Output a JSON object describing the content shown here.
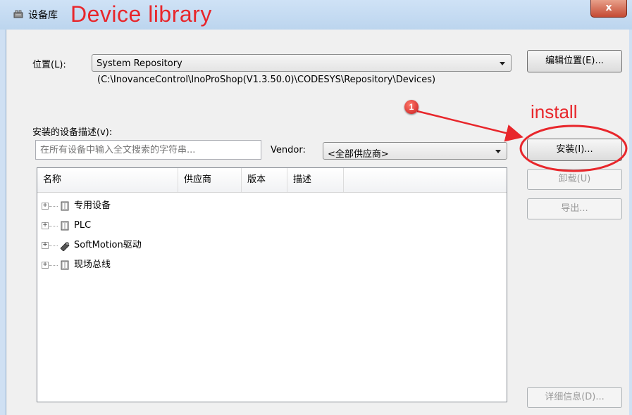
{
  "window": {
    "title": "设备库",
    "title_annotation": "Device library",
    "close_glyph": "x"
  },
  "location": {
    "label": "位置(L):",
    "value": "System Repository",
    "path": "(C:\\InovanceControl\\InoProShop(V1.3.50.0)\\CODESYS\\Repository\\Devices)",
    "edit_button": "编辑位置(E)..."
  },
  "installed": {
    "label": "安装的设备描述(v):",
    "search_placeholder": "在所有设备中输入全文搜索的字符串...",
    "vendor_label": "Vendor:",
    "vendor_value": "<全部供应商>"
  },
  "table": {
    "columns": [
      "名称",
      "供应商",
      "版本",
      "描述"
    ],
    "rows": [
      {
        "label": "专用设备",
        "icon": "device-folder-icon"
      },
      {
        "label": "PLC",
        "icon": "device-folder-icon"
      },
      {
        "label": "SoftMotion驱动",
        "icon": "softmotion-drive-icon"
      },
      {
        "label": "现场总线",
        "icon": "device-folder-icon"
      }
    ]
  },
  "buttons": {
    "install": "安装(I)...",
    "uninstall": "卸载(U)",
    "export": "导出...",
    "details": "详细信息(D)..."
  },
  "annotations": {
    "step_number": "1",
    "install_text": "install",
    "color": "#e8262b"
  }
}
